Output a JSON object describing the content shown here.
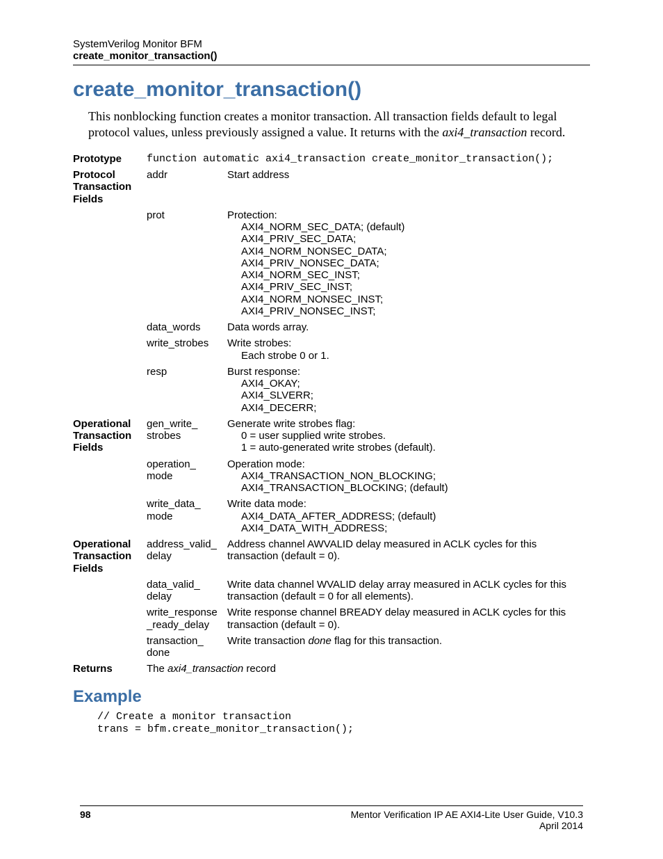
{
  "header": {
    "line1": "SystemVerilog Monitor BFM",
    "line2": "create_monitor_transaction()"
  },
  "title": "create_monitor_transaction()",
  "intro_pre": "This nonblocking function creates a monitor transaction. All transaction fields default to legal protocol values, unless previously assigned a value. It returns with the ",
  "intro_italic": "axi4_transaction",
  "intro_post": " record.",
  "labels": {
    "prototype": "Prototype",
    "protocol_fields": "Protocol Transaction Fields",
    "op_fields_1": "Operational Transaction Fields",
    "op_fields_2": "Operational Transaction Fields",
    "returns": "Returns",
    "example": "Example"
  },
  "prototype_code": "function automatic axi4_transaction create_monitor_transaction();",
  "rows": {
    "addr_name": "addr",
    "addr_desc": "Start address",
    "prot_name": "prot",
    "prot_title": "Protection:",
    "prot_l1": "AXI4_NORM_SEC_DATA; (default)",
    "prot_l2": "AXI4_PRIV_SEC_DATA;",
    "prot_l3": "AXI4_NORM_NONSEC_DATA;",
    "prot_l4": "AXI4_PRIV_NONSEC_DATA;",
    "prot_l5": "AXI4_NORM_SEC_INST;",
    "prot_l6": "AXI4_PRIV_SEC_INST;",
    "prot_l7": "AXI4_NORM_NONSEC_INST;",
    "prot_l8": "AXI4_PRIV_NONSEC_INST;",
    "dw_name": "data_words",
    "dw_desc": "Data words array.",
    "ws_name": "write_strobes",
    "ws_title": "Write strobes:",
    "ws_l1": "Each strobe 0 or 1.",
    "resp_name": "resp",
    "resp_title": "Burst response:",
    "resp_l1": "AXI4_OKAY;",
    "resp_l2": "AXI4_SLVERR;",
    "resp_l3": "AXI4_DECERR;",
    "gws_name": "gen_write_\nstrobes",
    "gws_title": "Generate write strobes flag:",
    "gws_l1": "0 = user supplied write strobes.",
    "gws_l2": "1 = auto-generated write strobes (default).",
    "om_name": "operation_\nmode",
    "om_title": "Operation mode:",
    "om_l1": "AXI4_TRANSACTION_NON_BLOCKING;",
    "om_l2": "AXI4_TRANSACTION_BLOCKING; (default)",
    "wdm_name": "write_data_\nmode",
    "wdm_title": "Write data mode:",
    "wdm_l1": "AXI4_DATA_AFTER_ADDRESS; (default)",
    "wdm_l2": "AXI4_DATA_WITH_ADDRESS;",
    "avd_name": "address_valid_\ndelay",
    "avd_desc": "Address channel AWVALID delay measured in ACLK cycles for this transaction (default = 0).",
    "dvd_name": "data_valid_\ndelay",
    "dvd_desc": "Write data channel WVALID delay array measured in ACLK cycles for this transaction (default = 0 for all elements).",
    "wrrd_name": "write_response\n_ready_delay",
    "wrrd_desc": "Write response channel BREADY delay measured in ACLK cycles for this transaction (default = 0).",
    "td_name": "transaction_\ndone",
    "td_pre": "Write transaction ",
    "td_it": "done",
    "td_post": " flag for this transaction."
  },
  "returns_pre": "The ",
  "returns_it": "axi4_transaction",
  "returns_post": " record",
  "example_code": "// Create a monitor transaction\ntrans = bfm.create_monitor_transaction();",
  "footer": {
    "page": "98",
    "guide": "Mentor Verification IP AE AXI4-Lite User Guide, V10.3",
    "date": "April 2014"
  }
}
